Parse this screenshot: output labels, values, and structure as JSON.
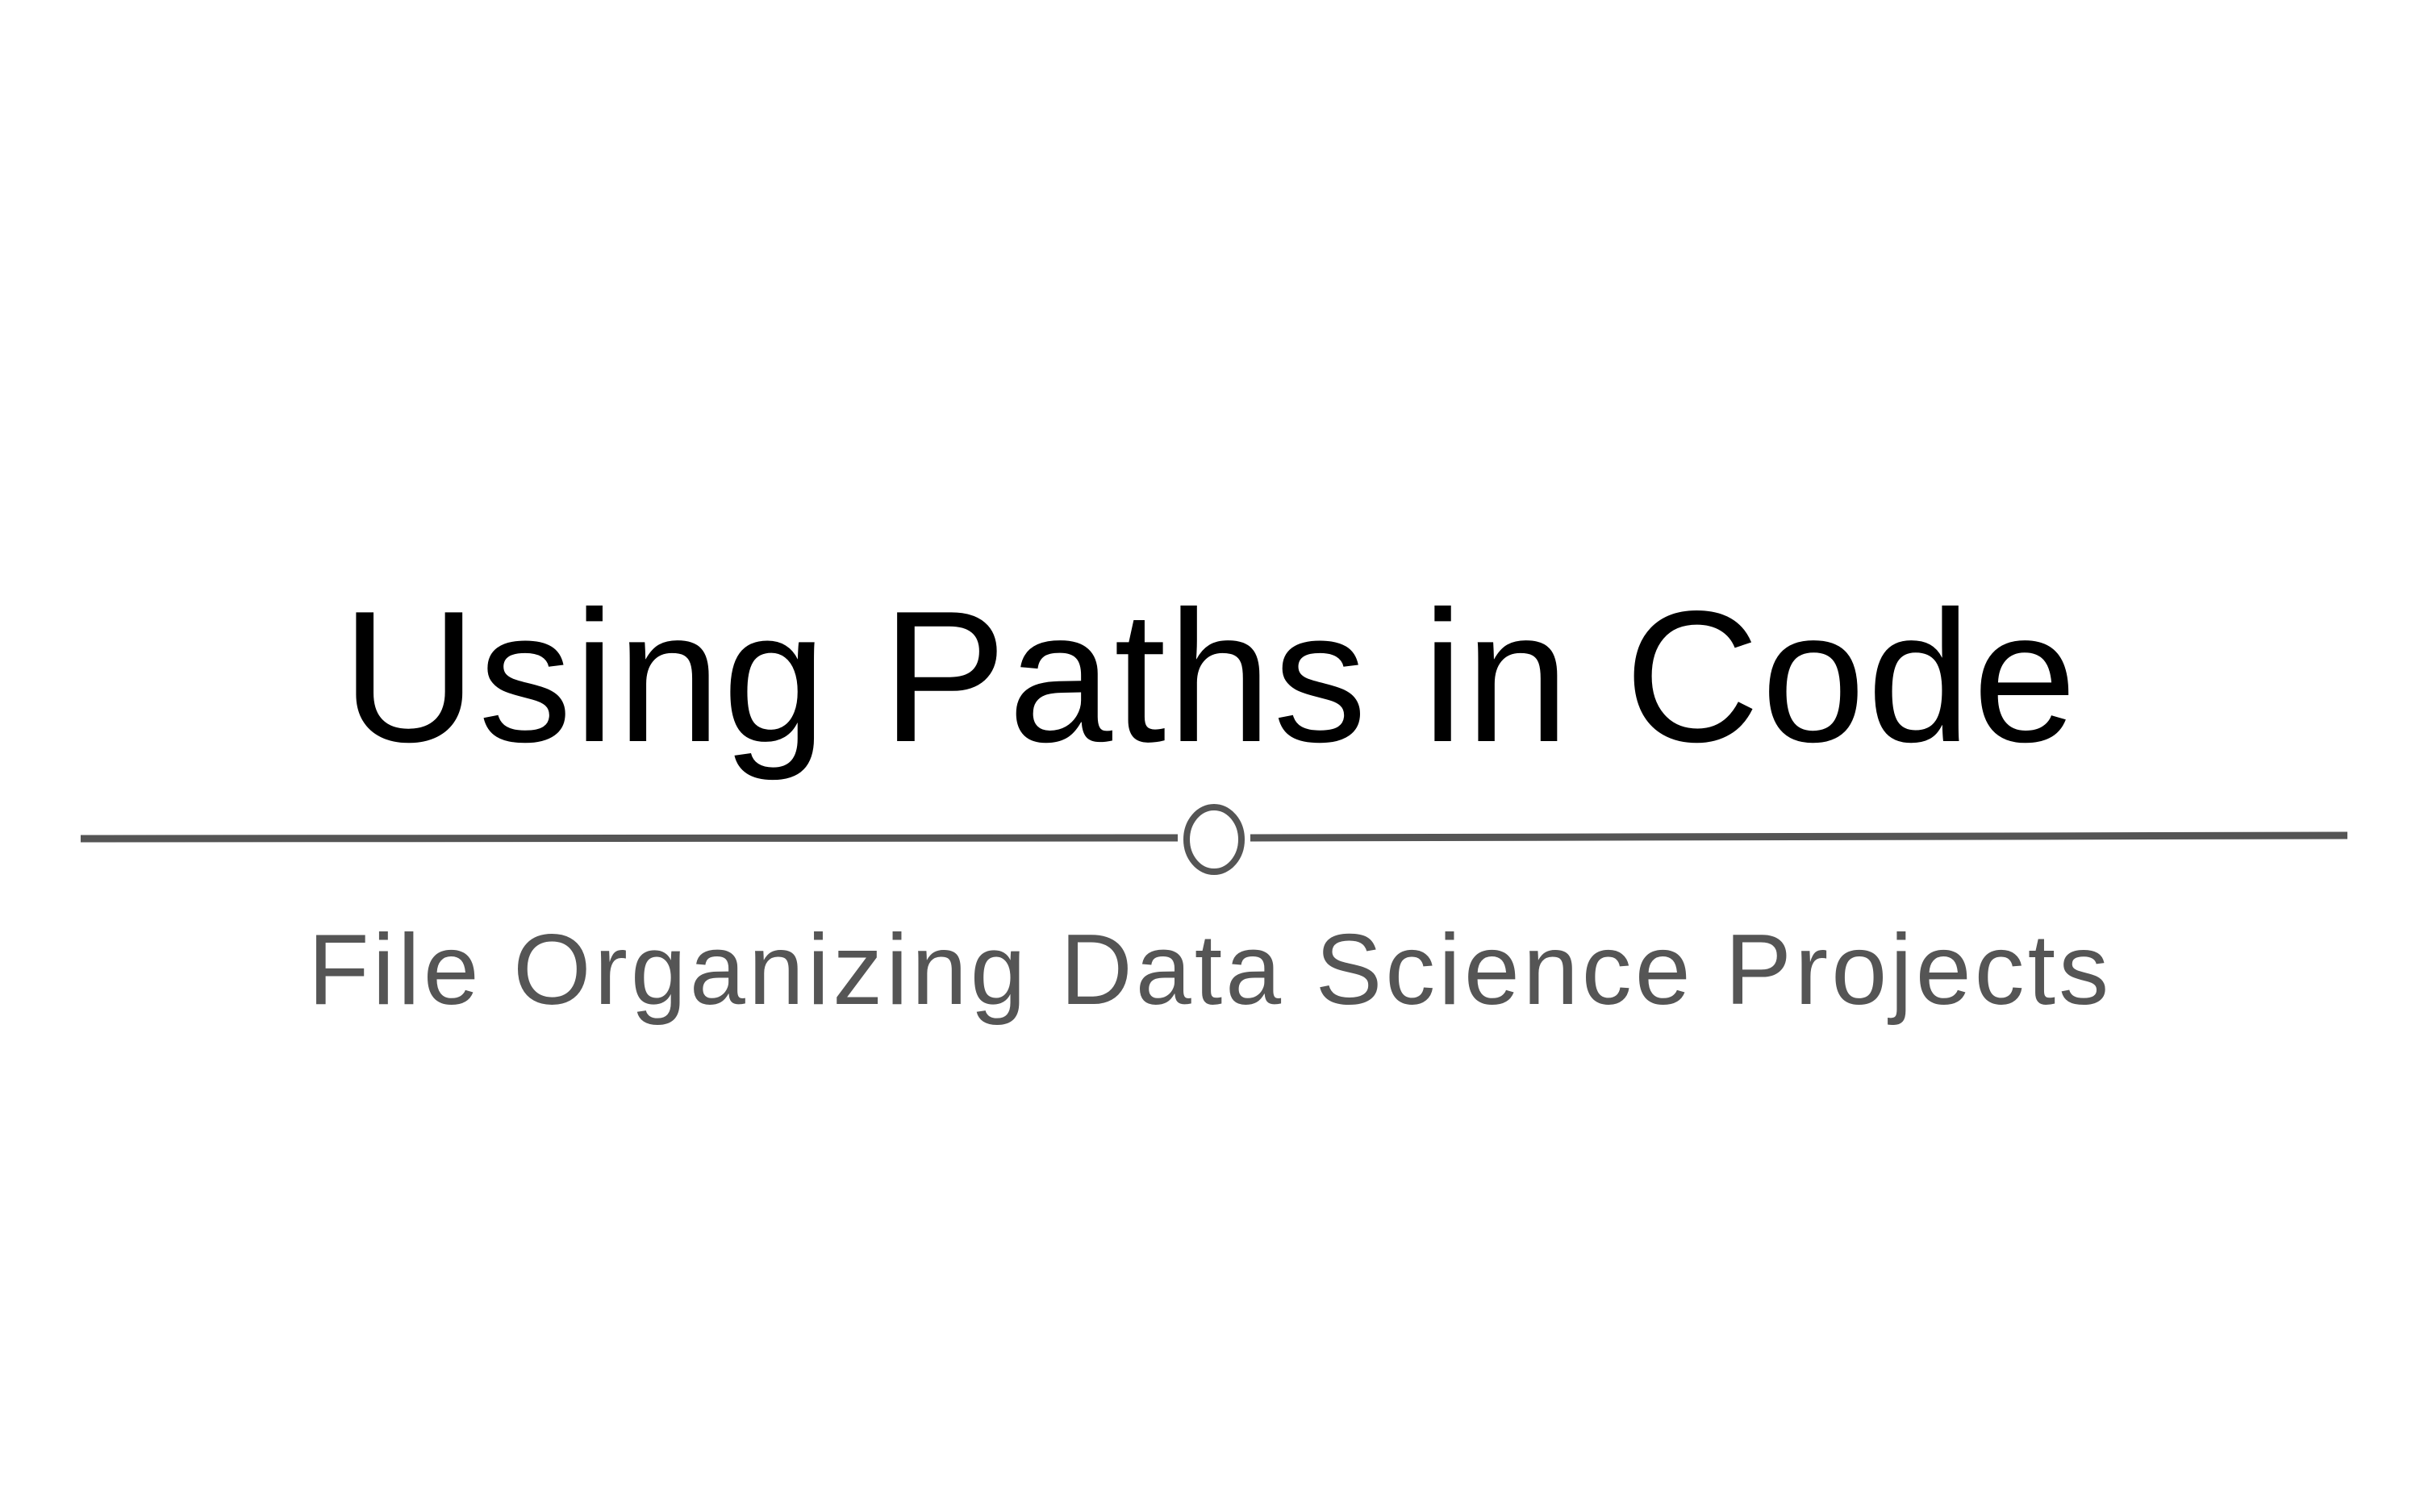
{
  "slide": {
    "title": "Using Paths in Code",
    "subtitle": "File Organizing Data Science Projects",
    "colors": {
      "background": "#ffffff",
      "title": "#000000",
      "subtitle": "#555555",
      "divider": "#555555"
    },
    "divider_icon": "circle-ornament-icon"
  }
}
